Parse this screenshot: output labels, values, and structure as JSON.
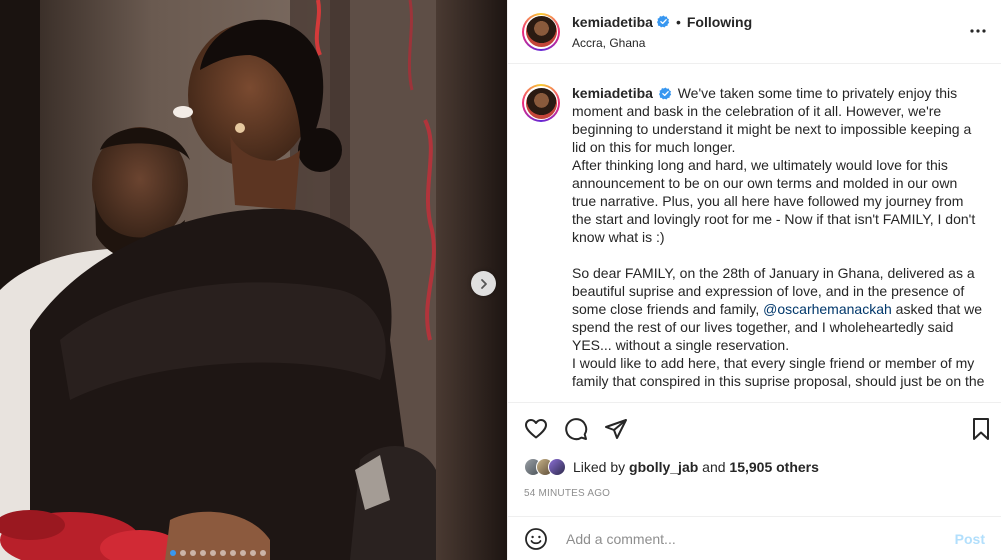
{
  "post": {
    "username": "kemiadetiba",
    "separator": "•",
    "follow_status": "Following",
    "location": "Accra, Ghana",
    "more_icon": "more-horizontal-icon",
    "verified_icon": "verified-badge-icon"
  },
  "media": {
    "next_icon": "chevron-right-icon",
    "slide_count": 10,
    "active_index": 0
  },
  "caption": {
    "username": "kemiadetiba",
    "p1": "We've taken some time to privately enjoy this moment and bask in the celebration of it all. However, we're beginning to understand it might be next to impossible keeping a lid on this for much longer.",
    "p2": "After thinking long and hard, we ultimately would love for this announcement to be on our own terms and molded in our own true narrative. Plus, you all here have followed my journey from the start and lovingly root for me - Now if that isn't FAMILY, I don't know what is :)",
    "p3_before": "So dear FAMILY, on the 28th of January in Ghana, delivered as a beautiful suprise and expression of love, and in the presence of some close friends and family,",
    "p3_mention": "@oscarhemanackah",
    "p3_after": "asked that we spend the rest of our lives together, and I wholeheartedly said YES... without a single reservation.",
    "p4": "I would like to add here, that every single friend or member of my family that conspired in this suprise proposal, should just be on the"
  },
  "actions": {
    "like_icon": "heart-icon",
    "comment_icon": "comment-icon",
    "share_icon": "share-icon",
    "save_icon": "bookmark-icon"
  },
  "likes": {
    "prefix": "Liked by",
    "user": "gbolly_jab",
    "middle": "and",
    "count": "15,905 others"
  },
  "timestamp": "54 MINUTES AGO",
  "comment": {
    "placeholder": "Add a comment...",
    "post_label": "Post",
    "emoji_icon": "emoji-icon"
  },
  "colors": {
    "verified": "#3897f0",
    "mention": "#00376b",
    "post_disabled": "#b2dffc",
    "muted": "#8e8e8e"
  }
}
